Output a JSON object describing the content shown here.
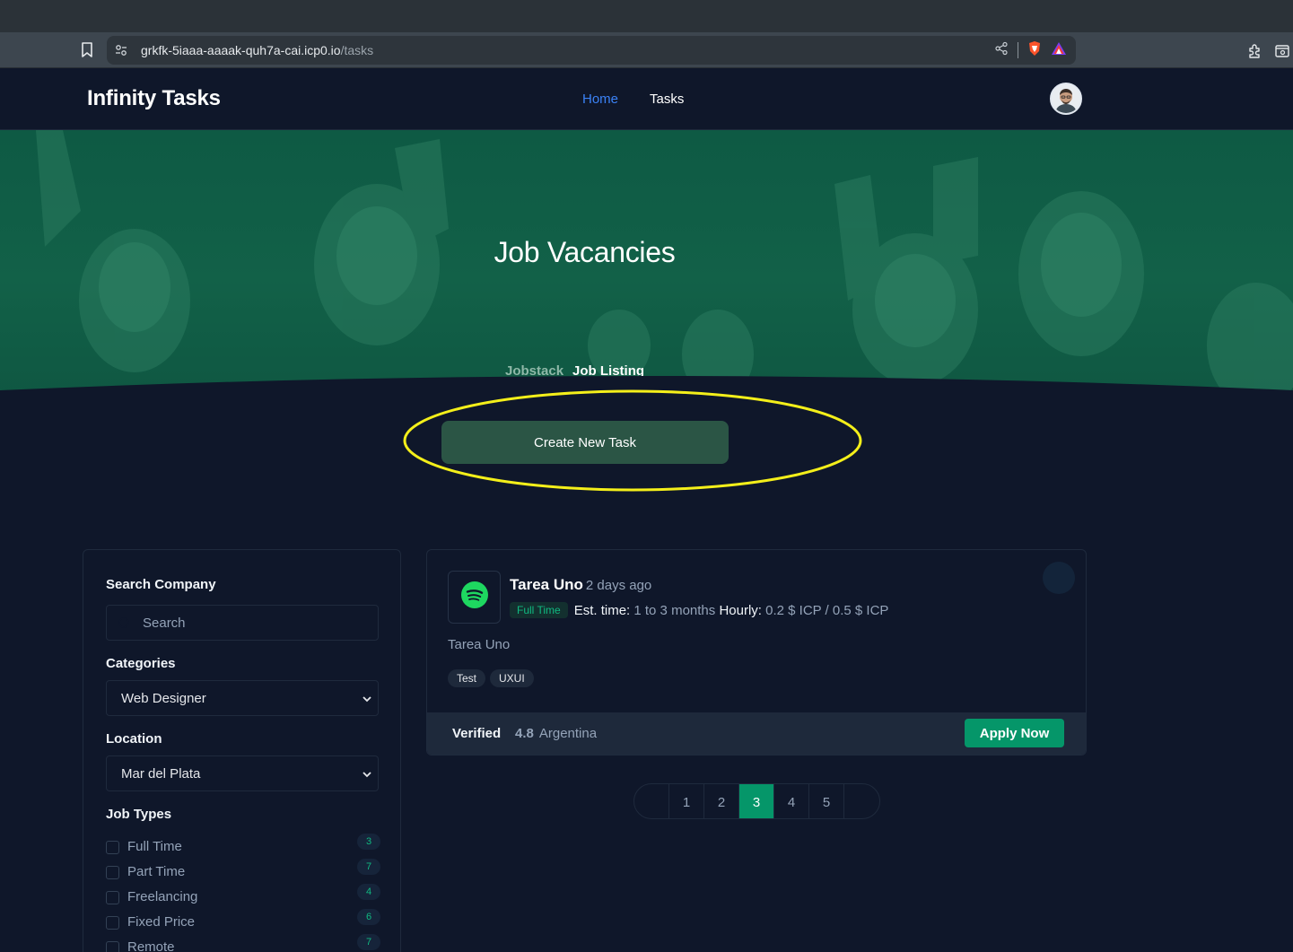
{
  "browser": {
    "url_host": "grkfk-5iaaa-aaaak-quh7a-cai.icp0.io",
    "url_path": "/tasks"
  },
  "navbar": {
    "brand": "Infinity Tasks",
    "links": [
      {
        "label": "Home",
        "active": true
      },
      {
        "label": "Tasks",
        "active": false
      }
    ]
  },
  "hero": {
    "title": "Job Vacancies",
    "breadcrumb": [
      "Jobstack",
      "Job Listing"
    ]
  },
  "create_button": {
    "label": "Create New Task",
    "highlight_color": "#f4ef1a"
  },
  "filters": {
    "search_company_label": "Search Company",
    "search_placeholder": "Search",
    "categories_label": "Categories",
    "category_selected": "Web Designer",
    "location_label": "Location",
    "location_selected": "Mar del Plata",
    "job_types_label": "Job Types",
    "job_types": [
      {
        "label": "Full Time",
        "count": "3",
        "checked": false
      },
      {
        "label": "Part Time",
        "count": "7",
        "checked": false
      },
      {
        "label": "Freelancing",
        "count": "4",
        "checked": false
      },
      {
        "label": "Fixed Price",
        "count": "6",
        "checked": false
      },
      {
        "label": "Remote",
        "count": "7",
        "checked": false
      }
    ]
  },
  "job": {
    "logo_icon": "spotify-icon",
    "title": "Tarea Uno",
    "posted": "2 days ago",
    "type_badge": "Full Time",
    "est_label": "Est. time:",
    "est_value": "1 to 3 months",
    "hourly_label": "Hourly:",
    "hourly_value": "0.2 $ ICP / 0.5 $ ICP",
    "description": "Tarea Uno",
    "tags": [
      "Test",
      "UXUI"
    ],
    "verified_label": "Verified",
    "rating": "4.8",
    "country": "Argentina",
    "apply_label": "Apply Now"
  },
  "pagination": {
    "pages": [
      "1",
      "2",
      "3",
      "4",
      "5"
    ],
    "current": "3"
  },
  "colors": {
    "page_bg": "#0f172a",
    "accent_green": "#059669",
    "link_blue": "#3b82f6",
    "hero_green": "#126148"
  }
}
